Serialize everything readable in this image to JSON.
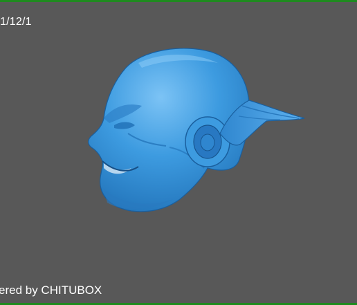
{
  "viewport": {
    "date_text": "1/12/1",
    "watermark_text": "ered by CHITUBOX"
  },
  "model": {
    "icon": "head-sculpture-model",
    "color": "#3d9be0",
    "shadow_color": "#1f6fb5",
    "highlight_color": "#7cc3f5"
  },
  "colors": {
    "background": "#585858",
    "frame_accent": "#1f8a1f",
    "text": "#ffffff"
  }
}
